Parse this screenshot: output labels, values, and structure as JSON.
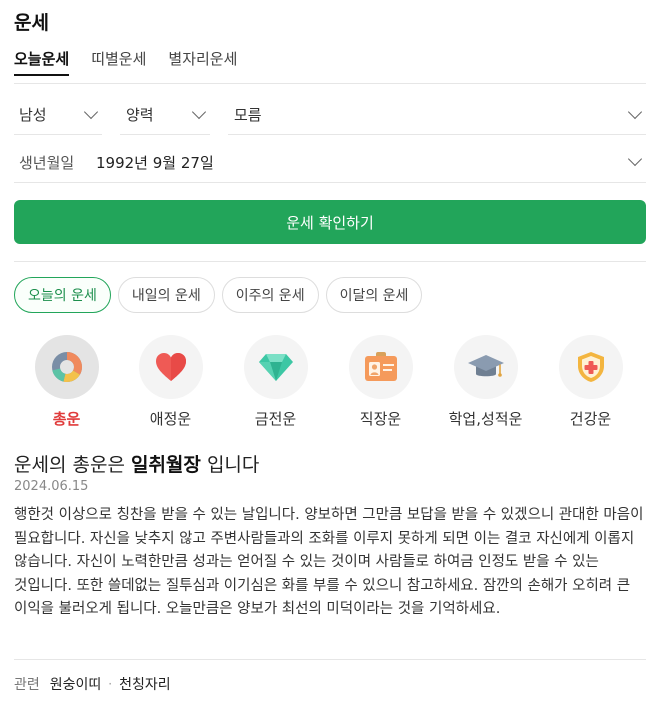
{
  "title": "운세",
  "tabs": [
    {
      "label": "오늘운세"
    },
    {
      "label": "띠별운세"
    },
    {
      "label": "별자리운세"
    }
  ],
  "form": {
    "gender": "남성",
    "calendar": "양력",
    "birth_time": "모름",
    "birth_label": "생년월일",
    "birth_value": "1992년 9월 27일"
  },
  "confirm_label": "운세 확인하기",
  "period_pills": [
    {
      "label": "오늘의 운세"
    },
    {
      "label": "내일의 운세"
    },
    {
      "label": "이주의 운세"
    },
    {
      "label": "이달의 운세"
    }
  ],
  "categories": [
    {
      "label": "총운",
      "icon": "donut-chart-icon"
    },
    {
      "label": "애정운",
      "icon": "heart-icon"
    },
    {
      "label": "금전운",
      "icon": "diamond-icon"
    },
    {
      "label": "직장운",
      "icon": "id-card-icon"
    },
    {
      "label": "학업,성적운",
      "icon": "graduation-cap-icon"
    },
    {
      "label": "건강운",
      "icon": "shield-cross-icon"
    }
  ],
  "result": {
    "prefix": "운세의 총운은",
    "keyword": "일취월장",
    "suffix": "입니다",
    "date": "2024.06.15",
    "text": "행한것 이상으로 칭찬을 받을 수 있는 날입니다. 양보하면 그만큼 보답을 받을 수 있겠으니 관대한 마음이 필요합니다. 자신을 낮추지 않고 주변사람들과의 조화를 이루지 못하게 되면 이는 결코 자신에게 이롭지 않습니다. 자신이 노력한만큼 성과는 얻어질 수 있는 것이며 사람들로 하여금 인정도 받을 수 있는 것입니다. 또한 쓸데없는 질투심과 이기심은 화를 부를 수 있으니 참고하세요. 잠깐의 손해가 오히려 큰 이익을 불러오게 됩니다. 오늘만큼은 양보가 최선의 미덕이라는 것을 기억하세요."
  },
  "related": {
    "label": "관련",
    "links": [
      "원숭이띠",
      "천칭자리"
    ],
    "separator": "·"
  },
  "colors": {
    "accent_green": "#22a55a",
    "active_category_red": "#e03b3b"
  }
}
